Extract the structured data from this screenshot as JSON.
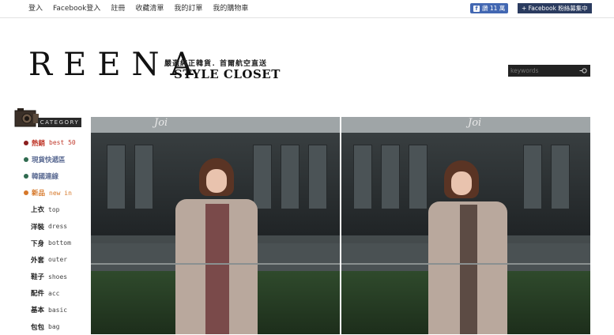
{
  "topnav": {
    "items": [
      "登入",
      "Facebook登入",
      "註冊",
      "收藏清單",
      "我的訂單",
      "我的購物車"
    ]
  },
  "facebook": {
    "like_label": "讚 11 萬",
    "fans_label": "+ Facebook 粉絲募集中"
  },
  "logo": {
    "main": "REENA",
    "tagline": "嚴選純正韓貨．首爾航空直送",
    "sub": "STYLE CLOSET"
  },
  "search": {
    "placeholder": "keywords"
  },
  "category": {
    "heading": "CATEGORY",
    "featured": [
      {
        "zh": "熱銷",
        "en": "best 50",
        "color": "#c0392b",
        "dot": "#8b1e1e"
      },
      {
        "zh": "現貨快遞區",
        "en": "",
        "color": "#5b6b93",
        "dot": "#2f6a4f"
      },
      {
        "zh": "韓國連線",
        "en": "",
        "color": "#5b6b93",
        "dot": "#2f6a4f"
      },
      {
        "zh": "新品",
        "en": "new in",
        "color": "#d6782a",
        "dot": "#d6782a"
      }
    ],
    "items": [
      {
        "zh": "上衣",
        "en": "top"
      },
      {
        "zh": "洋裝",
        "en": "dress"
      },
      {
        "zh": "下身",
        "en": "bottom"
      },
      {
        "zh": "外套",
        "en": "outer"
      },
      {
        "zh": "鞋子",
        "en": "shoes"
      },
      {
        "zh": "配件",
        "en": "acc"
      },
      {
        "zh": "基本",
        "en": "basic"
      },
      {
        "zh": "包包",
        "en": "bag"
      }
    ]
  },
  "banner": {
    "sign_text": "Joi"
  }
}
